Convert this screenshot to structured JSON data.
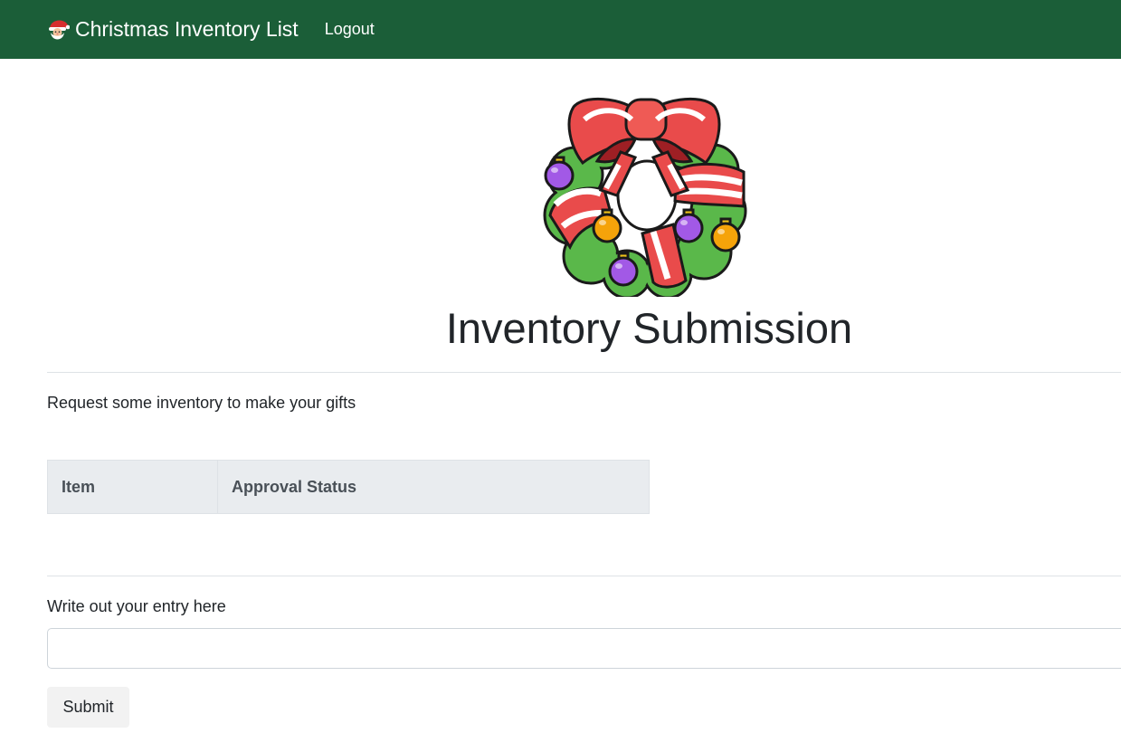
{
  "navbar": {
    "brand_icon": "santa-face-icon",
    "brand": "Christmas Inventory List",
    "logout": "Logout",
    "background_color": "#1b5e38"
  },
  "hero": {
    "image": "christmas-wreath-icon",
    "title": "Inventory Submission"
  },
  "intro": "Request some inventory to make your gifts",
  "table": {
    "columns": [
      "Item",
      "Approval Status"
    ],
    "rows": []
  },
  "entry": {
    "label": "Write out your entry here",
    "value": "",
    "placeholder": ""
  },
  "submit_label": "Submit"
}
